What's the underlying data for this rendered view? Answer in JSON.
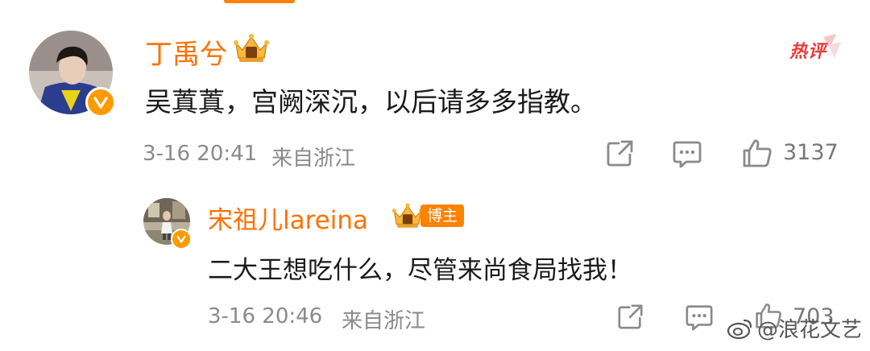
{
  "comment": {
    "username": "丁禹兮",
    "text": "吴蒖蒖，宫阙深沉，以后请多多指教。",
    "timestamp": "3-16 20:41",
    "location": "来自浙江",
    "like_count": "3137",
    "hot_badge": "热评"
  },
  "reply": {
    "username": "宋祖儿lareina",
    "author_badge": "博主",
    "text": "二大王想吃什么，尽管来尚食局找我！",
    "timestamp": "3-16 20:46",
    "location": "来自浙江",
    "like_count": "703"
  },
  "watermark": {
    "text": "@浪花文艺"
  },
  "colors": {
    "accent": "#ff8200",
    "username": "#ff7000",
    "hot": "#e93b3b",
    "verified": "#ff9b00"
  },
  "icons": [
    "verified-icon",
    "crown-vip-icon",
    "share-icon",
    "comment-icon",
    "like-icon",
    "weibo-logo-icon"
  ]
}
